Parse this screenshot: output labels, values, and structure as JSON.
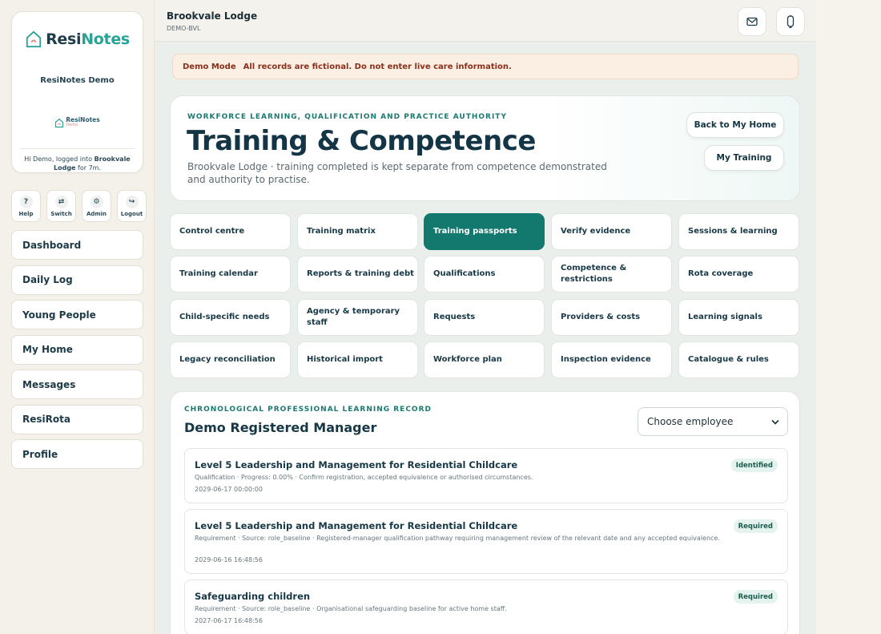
{
  "sidebar": {
    "brand": {
      "name_part1": "Resi",
      "name_part2": "Notes",
      "demo": "ResiNotes Demo",
      "mini_name": "ResiNotes",
      "mini_tag": "Demo"
    },
    "user": {
      "prefix": "Hi Demo, logged into ",
      "home": "Brookvale Lodge",
      "suffix": " for 7m."
    },
    "quick": [
      {
        "label": "Help",
        "icon": "?"
      },
      {
        "label": "Switch",
        "icon": "⇄"
      },
      {
        "label": "Admin",
        "icon": "⚙"
      },
      {
        "label": "Logout",
        "icon": "↪"
      }
    ],
    "nav": [
      "Dashboard",
      "Daily Log",
      "Young People",
      "My Home",
      "Messages",
      "ResiRota",
      "Profile"
    ]
  },
  "topbar": {
    "home_name": "Brookvale Lodge",
    "home_code": "DEMO-BVL",
    "icons": [
      "mail-icon",
      "notification-icon"
    ]
  },
  "banner": {
    "label": "Demo Mode",
    "text": "All records are fictional. Do not enter live care information."
  },
  "hero": {
    "eyebrow": "WORKFORCE LEARNING, QUALIFICATION AND PRACTICE AUTHORITY",
    "title": "Training & Competence",
    "subtitle": "Brookvale Lodge · training completed is kept separate from competence demonstrated and authority to practise.",
    "back_button": "Back to My Home",
    "my_training_button": "My Training"
  },
  "tiles": [
    "Control centre",
    "Training matrix",
    "Training passports",
    "Verify evidence",
    "Sessions & learning",
    "Training calendar",
    "Reports & training debt",
    "Qualifications",
    "Competence & restrictions",
    "Rota coverage",
    "Child-specific needs",
    "Agency & temporary staff",
    "Requests",
    "Providers & costs",
    "Learning signals",
    "Legacy reconciliation",
    "Historical import",
    "Workforce plan",
    "Inspection evidence",
    "Catalogue & rules"
  ],
  "active_tile": "Training passports",
  "record": {
    "eyebrow": "CHRONOLOGICAL PROFESSIONAL LEARNING RECORD",
    "title": "Demo Registered Manager",
    "select_value": "Choose employee",
    "entries": [
      {
        "title": "Level 5 Leadership and Management for Residential Childcare",
        "meta": "Qualification · Progress: 0.00% · Confirm registration, accepted equivalence or authorised circumstances.",
        "date": "2029-06-17 00:00:00",
        "badge": "Identified"
      },
      {
        "title": "Level 5 Leadership and Management for Residential Childcare",
        "meta": "Requirement · Source: role_baseline · Registered-manager qualification pathway requiring management review of the relevant date and any accepted equivalence.",
        "date": "2029-06-16 16:48:56",
        "badge": "Required"
      },
      {
        "title": "Safeguarding children",
        "meta": "Requirement · Source: role_baseline · Organisational safeguarding baseline for active home staff.",
        "date": "2027-06-17 16:48:56",
        "badge": "Required"
      }
    ]
  },
  "colors": {
    "accent": "#13786e",
    "navy": "#133545",
    "banner_bg": "#fbeee2",
    "banner_text": "#8a2f1c"
  }
}
